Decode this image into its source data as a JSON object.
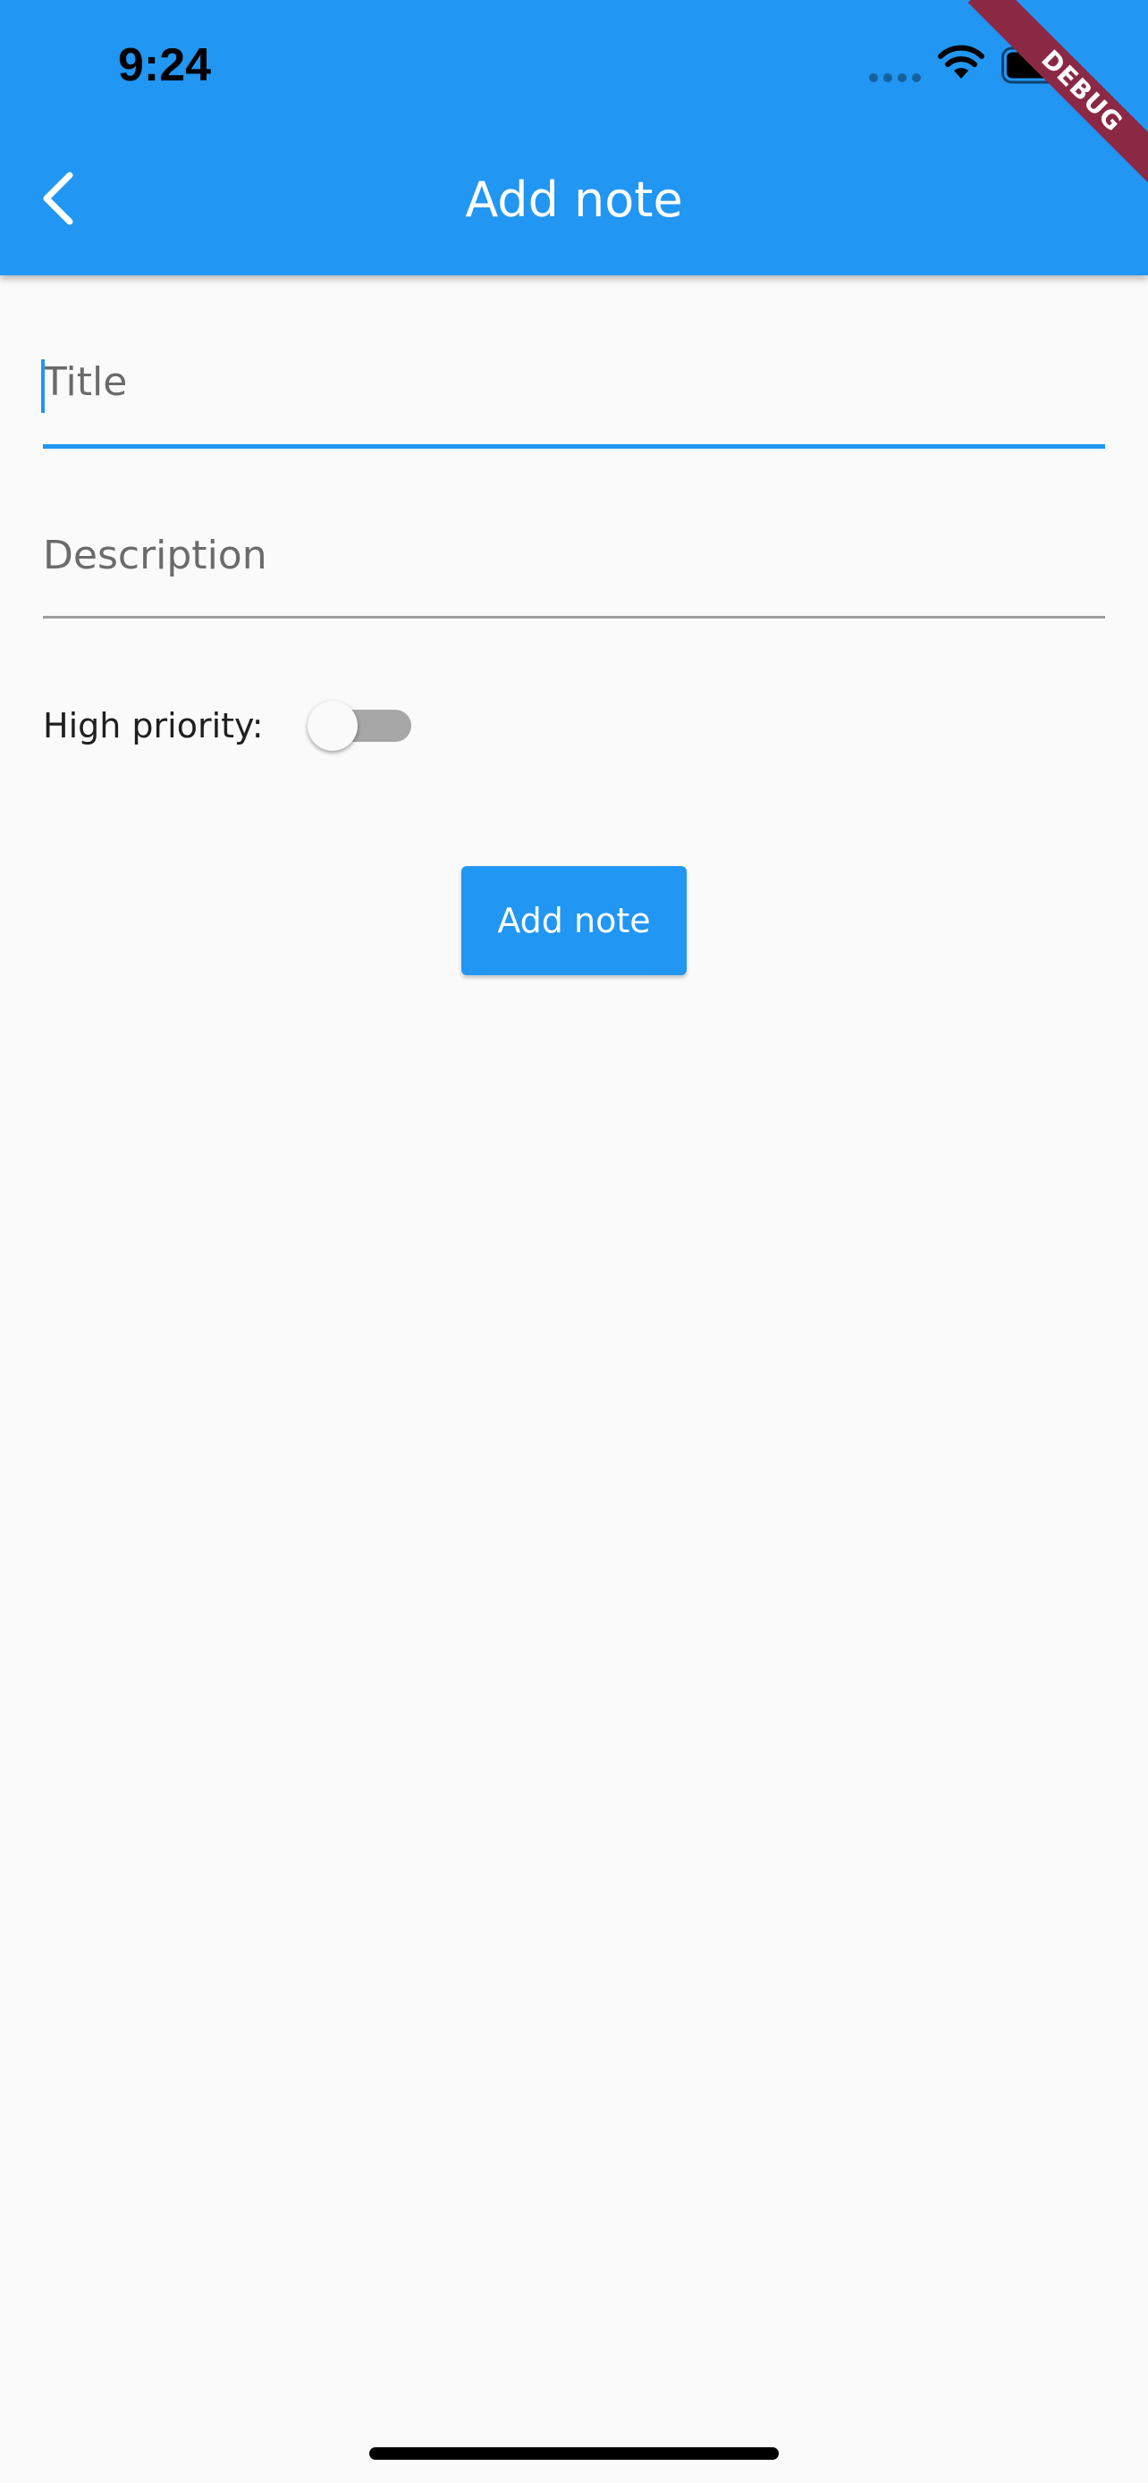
{
  "status_bar": {
    "time": "9:24",
    "icons": [
      "signal-dots-icon",
      "wifi-icon",
      "battery-icon"
    ]
  },
  "app_bar": {
    "title": "Add note",
    "back_icon": "chevron-left-icon",
    "background_color": "#2196f3"
  },
  "debug_banner": {
    "label": "DEBUG",
    "color": "#8b2945"
  },
  "form": {
    "title_field": {
      "value": "",
      "placeholder": "Title",
      "focused": true
    },
    "description_field": {
      "value": "",
      "placeholder": "Description",
      "focused": false
    },
    "priority": {
      "label": "High priority:",
      "enabled": false
    },
    "submit_label": "Add note"
  },
  "colors": {
    "accent": "#2196f3",
    "background": "#fafafa",
    "switch_track_off": "#a7a7a7"
  }
}
